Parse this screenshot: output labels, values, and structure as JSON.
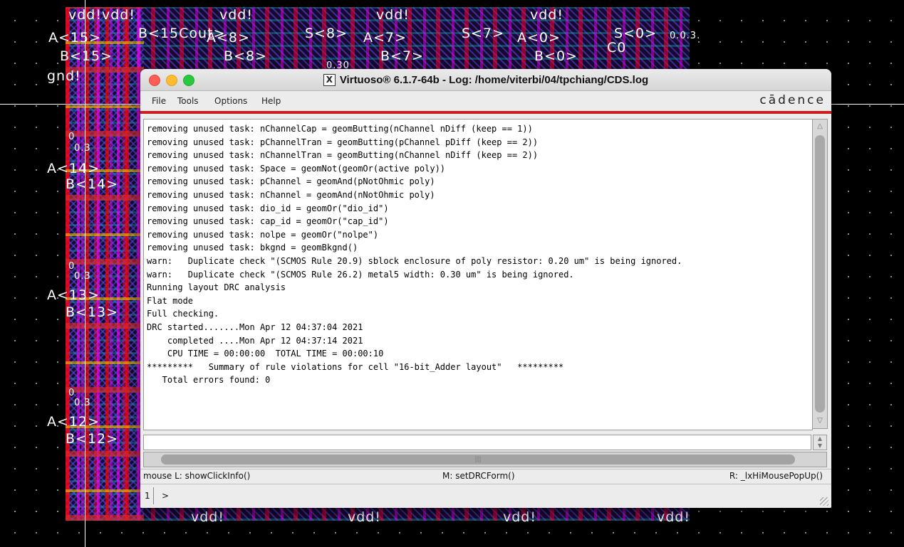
{
  "layout_labels": {
    "vdd_top_1": "vdd!vdd!",
    "vdd_top_2": "vdd!",
    "vdd_top_3": "vdd!",
    "vdd_top_4": "vdd!",
    "a15": "A<15>",
    "b15cout": "B<15Cout>",
    "a8": "A<8>",
    "s8": "S<8>",
    "a7": "A<7>",
    "s7": "S<7>",
    "a0": "A<0>",
    "s0": "S<0>",
    "b15": "B<15>",
    "b8": "B<8>",
    "b7": "B<7>",
    "b0": "B<0>",
    "c0": "C0",
    "gnd": "gnd!",
    "a14": "A<14>",
    "b14": "B<14>",
    "a13": "A<13>",
    "b13": "B<13>",
    "a12": "A<12>",
    "b12": "B<12>",
    "vdd_bottom": "vdd!",
    "val_03": "0.3",
    "val_0": "0",
    "val_030": "0.30",
    "val_003": "0.0.3."
  },
  "window": {
    "title": "Virtuoso® 6.1.7-64b - Log: /home/viterbi/04/tpchiang/CDS.log",
    "brand": "cādence"
  },
  "menu": {
    "file": "File",
    "tools": "Tools",
    "options": "Options",
    "help": "Help"
  },
  "log_lines": [
    "removing unused task: nChannelCap = geomButting(nChannel nDiff (keep == 1))",
    "removing unused task: pChannelTran = geomButting(pChannel pDiff (keep == 2))",
    "removing unused task: nChannelTran = geomButting(nChannel nDiff (keep == 2))",
    "removing unused task: Space = geomNot(geomOr(active poly))",
    "removing unused task: pChannel = geomAnd(pNotOhmic poly)",
    "removing unused task: nChannel = geomAnd(nNotOhmic poly)",
    "removing unused task: dio_id = geomOr(\"dio_id\")",
    "removing unused task: cap_id = geomOr(\"cap_id\")",
    "removing unused task: nolpe = geomOr(\"nolpe\")",
    "removing unused task: bkgnd = geomBkgnd()",
    "warn:   Duplicate check \"(SCMOS Rule 20.9) sblock enclosure of poly resistor: 0.20 um\" is being ignored.",
    "warn:   Duplicate check \"(SCMOS Rule 26.2) metal5 width: 0.30 um\" is being ignored.",
    "Running layout DRC analysis",
    "Flat mode",
    "Full checking.",
    "DRC started.......Mon Apr 12 04:37:04 2021",
    "    completed ....Mon Apr 12 04:37:14 2021",
    "    CPU TIME = 00:00:00  TOTAL TIME = 00:00:10",
    "*********   Summary of rule violations for cell \"16-bit_Adder layout\"   *********",
    "   Total errors found: 0"
  ],
  "command_input": {
    "value": ""
  },
  "status": {
    "left": "mouse L: showClickInfo()",
    "middle": "M: setDRCForm()",
    "right": "R: _lxHiMousePopUp()"
  },
  "prompt": {
    "number": "1",
    "symbol": ">"
  },
  "colors": {
    "accent_red": "#cc1e1e",
    "close": "#ff5f57",
    "minimize": "#febc2e",
    "maximize": "#28c840"
  }
}
